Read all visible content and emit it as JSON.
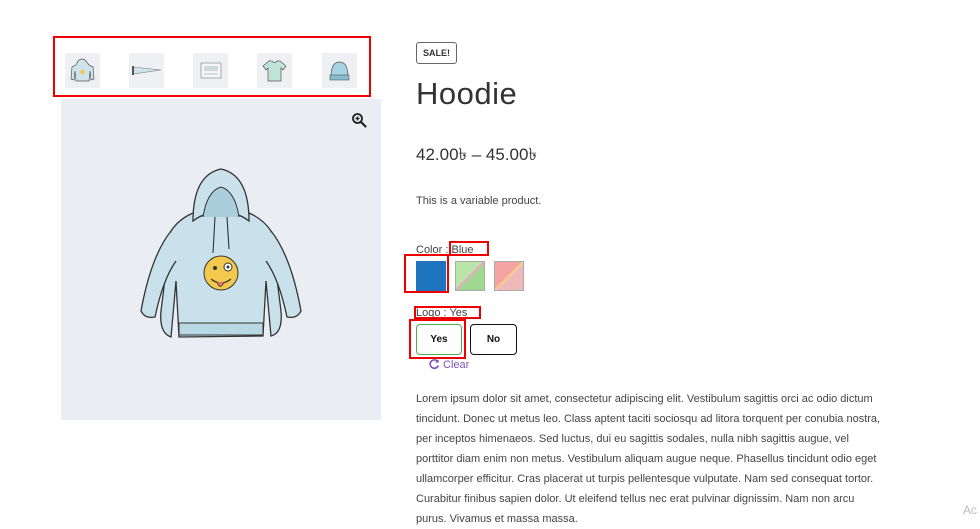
{
  "gallery": {
    "thumbnails": [
      {
        "name": "hoodie-thumbnail"
      },
      {
        "name": "pennant-thumbnail"
      },
      {
        "name": "poster-thumbnail"
      },
      {
        "name": "tshirt-thumbnail"
      },
      {
        "name": "beanie-thumbnail"
      }
    ],
    "main_image": "hoodie-image",
    "zoom_icon": "magnifier-plus-icon"
  },
  "product": {
    "badge": "SALE!",
    "title": "Hoodie",
    "price": "42.00৳ – 45.00৳",
    "short_description": "This is a variable product.",
    "color": {
      "label": "Color",
      "separator": ":",
      "selected": "Blue",
      "swatches": [
        {
          "name": "blue",
          "color": "#1e73be"
        },
        {
          "name": "green",
          "color": "#a8dc9a"
        },
        {
          "name": "red",
          "color": "#ef9a9a"
        }
      ]
    },
    "logo": {
      "label": "Logo",
      "separator": ":",
      "selected": "Yes",
      "options": [
        "Yes",
        "No"
      ]
    },
    "clear_label": "Clear",
    "clear_icon": "refresh-icon",
    "description": "Lorem ipsum dolor sit amet, consectetur adipiscing elit. Vestibulum sagittis orci ac odio dictum tincidunt. Donec ut metus leo. Class aptent taciti sociosqu ad litora torquent per conubia nostra, per inceptos himenaeos. Sed luctus, dui eu sagittis sodales, nulla nibh sagittis augue, vel porttitor diam enim non metus. Vestibulum aliquam augue neque. Phasellus tincidunt odio eget ullamcorper efficitur. Cras placerat ut turpis pellentesque vulputate. Nam sed consequat tortor. Curabitur finibus sapien dolor. Ut eleifend tellus nec erat pulvinar dignissim. Nam non arcu purus. Vivamus et massa massa."
  },
  "edge_text": "Ac"
}
